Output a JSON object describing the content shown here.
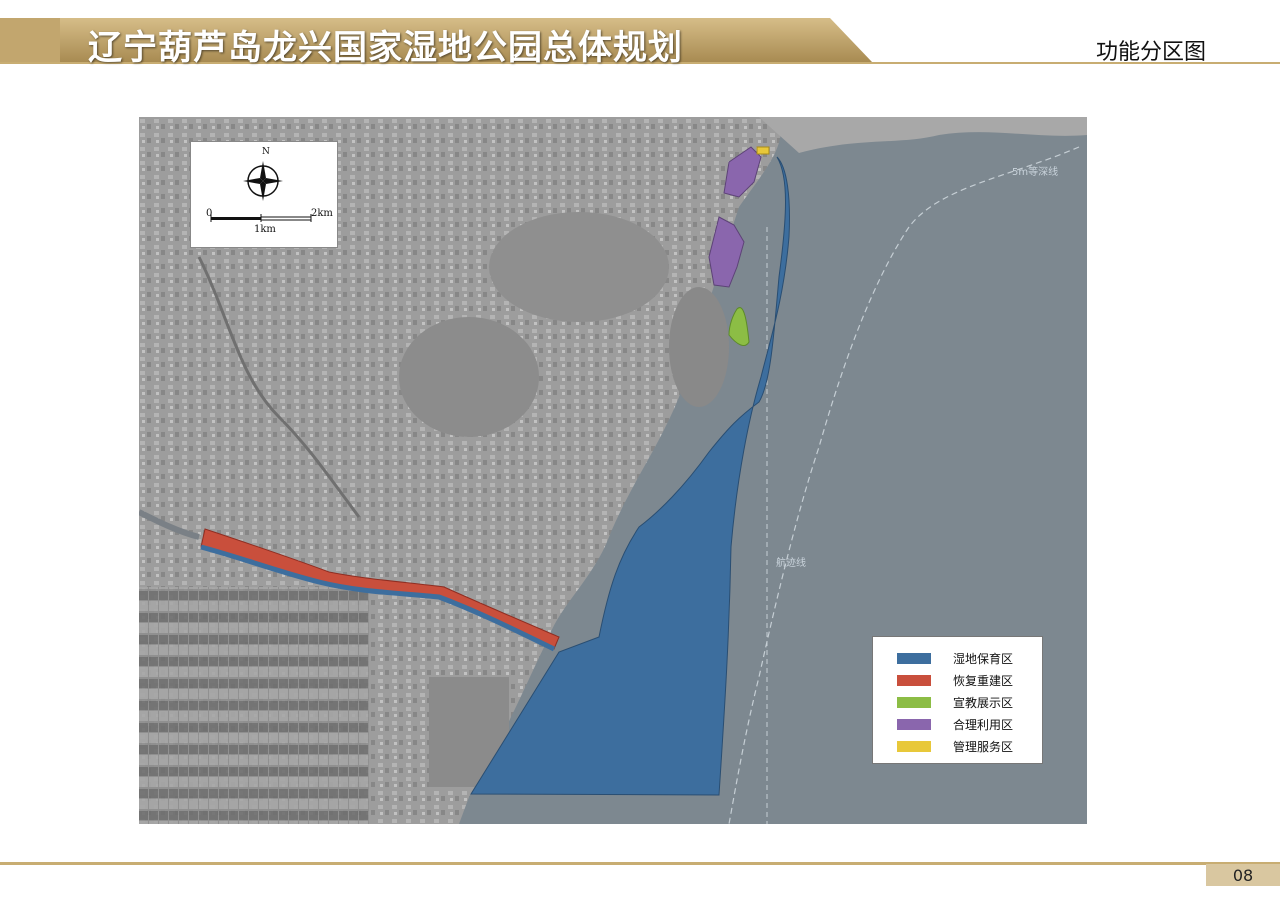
{
  "header": {
    "title": "辽宁葫芦岛龙兴国家湿地公园总体规划",
    "section": "功能分区图"
  },
  "map": {
    "north_letter": "N",
    "scale": {
      "start": "0",
      "mid": "1km",
      "end": "2km"
    },
    "labels": {
      "isobath": "5m等深线",
      "shipping_route": "航迹线"
    },
    "colors": {
      "sea": "#7f8a91",
      "land": "#9b9b9b"
    }
  },
  "legend": {
    "items": [
      {
        "label": "湿地保育区",
        "color": "#3d6e9e"
      },
      {
        "label": "恢复重建区",
        "color": "#c94f3c"
      },
      {
        "label": "宣教展示区",
        "color": "#8cbd45"
      },
      {
        "label": "合理利用区",
        "color": "#8a66ad"
      },
      {
        "label": "管理服务区",
        "color": "#e8c83a"
      }
    ]
  },
  "footer": {
    "page": "08"
  }
}
